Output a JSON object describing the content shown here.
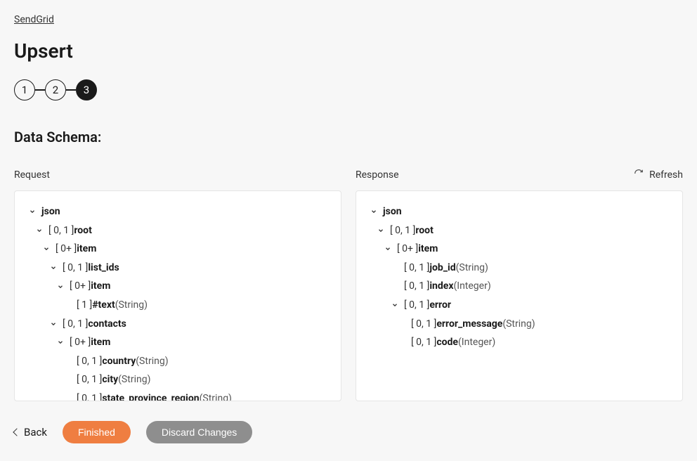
{
  "breadcrumb": "SendGrid",
  "page_title": "Upsert",
  "stepper": {
    "steps": [
      "1",
      "2",
      "3"
    ],
    "active_index": 2
  },
  "section_title": "Data Schema:",
  "refresh_label": "Refresh",
  "request": {
    "label": "Request",
    "tree": [
      {
        "indent": 0,
        "toggle": true,
        "card": "",
        "name": "json",
        "type": ""
      },
      {
        "indent": 1,
        "toggle": true,
        "card": "[ 0, 1 ]",
        "name": "root",
        "type": ""
      },
      {
        "indent": 2,
        "toggle": true,
        "card": "[ 0+ ]",
        "name": "item",
        "type": ""
      },
      {
        "indent": 3,
        "toggle": true,
        "card": "[ 0, 1 ]",
        "name": "list_ids",
        "type": ""
      },
      {
        "indent": 4,
        "toggle": true,
        "card": "[ 0+ ]",
        "name": "item",
        "type": ""
      },
      {
        "indent": 5,
        "toggle": false,
        "card": "[ 1 ]",
        "name": "#text",
        "type": "(String)"
      },
      {
        "indent": 3,
        "toggle": true,
        "card": "[ 0, 1 ]",
        "name": "contacts",
        "type": ""
      },
      {
        "indent": 4,
        "toggle": true,
        "card": "[ 0+ ]",
        "name": "item",
        "type": ""
      },
      {
        "indent": 5,
        "toggle": false,
        "card": "[ 0, 1 ]",
        "name": "country",
        "type": "(String)"
      },
      {
        "indent": 5,
        "toggle": false,
        "card": "[ 0, 1 ]",
        "name": "city",
        "type": "(String)"
      },
      {
        "indent": 5,
        "toggle": false,
        "card": "[ 0, 1 ]",
        "name": "state_province_region",
        "type": "(String)"
      }
    ]
  },
  "response": {
    "label": "Response",
    "tree": [
      {
        "indent": 0,
        "toggle": true,
        "card": "",
        "name": "json",
        "type": ""
      },
      {
        "indent": 1,
        "toggle": true,
        "card": "[ 0, 1 ]",
        "name": "root",
        "type": ""
      },
      {
        "indent": 2,
        "toggle": true,
        "card": "[ 0+ ]",
        "name": "item",
        "type": ""
      },
      {
        "indent": 3,
        "toggle": false,
        "card": "[ 0, 1 ]",
        "name": "job_id",
        "type": "(String)"
      },
      {
        "indent": 3,
        "toggle": false,
        "card": "[ 0, 1 ]",
        "name": "index",
        "type": "(Integer)"
      },
      {
        "indent": 3,
        "toggle": true,
        "card": "[ 0, 1 ]",
        "name": "error",
        "type": ""
      },
      {
        "indent": 4,
        "toggle": false,
        "card": "[ 0, 1 ]",
        "name": "error_message",
        "type": "(String)"
      },
      {
        "indent": 4,
        "toggle": false,
        "card": "[ 0, 1 ]",
        "name": "code",
        "type": "(Integer)"
      }
    ]
  },
  "footer": {
    "back": "Back",
    "finished": "Finished",
    "discard": "Discard Changes"
  }
}
